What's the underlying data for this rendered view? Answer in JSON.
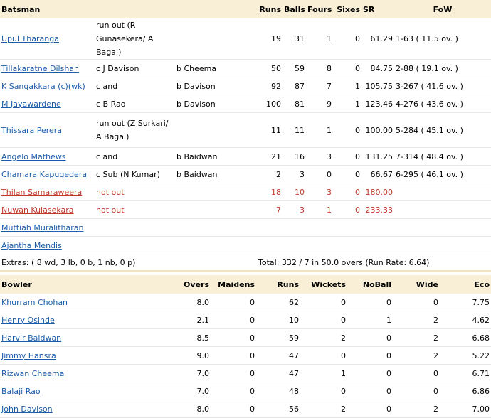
{
  "batting": {
    "headers": {
      "batsman": "Batsman",
      "runs": "Runs",
      "balls": "Balls",
      "fours": "Fours",
      "sixes": "Sixes",
      "sr": "SR",
      "fow": "FoW"
    },
    "rows": [
      {
        "name": "Upul Tharanga",
        "how1": "run out (R Gunasekera/ A Bagai)",
        "how2": "",
        "runs": "19",
        "balls": "31",
        "fours": "1",
        "sixes": "0",
        "sr": "61.29",
        "fow": "1-63 ( 11.5 ov. )"
      },
      {
        "name": "Tillakaratne Dilshan",
        "how1": "c J Davison",
        "how2": "b Cheema",
        "runs": "50",
        "balls": "59",
        "fours": "8",
        "sixes": "0",
        "sr": "84.75",
        "fow": "2-88 ( 19.1 ov. )"
      },
      {
        "name": "K Sangakkara (c)(wk)",
        "how1": "c and",
        "how2": "b Davison",
        "runs": "92",
        "balls": "87",
        "fours": "7",
        "sixes": "1",
        "sr": "105.75",
        "fow": "3-267 ( 41.6 ov. )"
      },
      {
        "name": "M Jayawardene",
        "how1": "c B Rao",
        "how2": "b Davison",
        "runs": "100",
        "balls": "81",
        "fours": "9",
        "sixes": "1",
        "sr": "123.46",
        "fow": "4-276 ( 43.6 ov. )"
      },
      {
        "name": "Thissara Perera",
        "how1": "run out (Z Surkari/ A Bagai)",
        "how2": "",
        "runs": "11",
        "balls": "11",
        "fours": "1",
        "sixes": "0",
        "sr": "100.00",
        "fow": "5-284 ( 45.1 ov. )"
      },
      {
        "name": "Angelo Mathews",
        "how1": "c and",
        "how2": "b Baidwan",
        "runs": "21",
        "balls": "16",
        "fours": "3",
        "sixes": "0",
        "sr": "131.25",
        "fow": "7-314 ( 48.4 ov. )"
      },
      {
        "name": "Chamara Kapugedera",
        "how1": "c Sub (N Kumar)",
        "how2": "b Baidwan",
        "runs": "2",
        "balls": "3",
        "fours": "0",
        "sixes": "0",
        "sr": "66.67",
        "fow": "6-295 ( 46.1 ov. )"
      },
      {
        "name": "Thilan Samaraweera",
        "how1": "not out",
        "how2": "",
        "runs": "18",
        "balls": "10",
        "fours": "3",
        "sixes": "0",
        "sr": "180.00",
        "fow": ""
      },
      {
        "name": "Nuwan Kulasekara",
        "how1": "not out",
        "how2": "",
        "runs": "7",
        "balls": "3",
        "fours": "1",
        "sixes": "0",
        "sr": "233.33",
        "fow": ""
      },
      {
        "name": "Muttiah Muralitharan",
        "how1": "",
        "how2": "",
        "runs": "",
        "balls": "",
        "fours": "",
        "sixes": "",
        "sr": "",
        "fow": ""
      },
      {
        "name": "Ajantha Mendis",
        "how1": "",
        "how2": "",
        "runs": "",
        "balls": "",
        "fours": "",
        "sixes": "",
        "sr": "",
        "fow": ""
      }
    ],
    "extras": "Extras: ( 8 wd, 3 lb, 0 b, 1 nb, 0 p)",
    "total": "Total: 332 / 7 in 50.0 overs (Run Rate: 6.64)"
  },
  "bowling": {
    "headers": {
      "bowler": "Bowler",
      "overs": "Overs",
      "maidens": "Maidens",
      "runs": "Runs",
      "wickets": "Wickets",
      "noball": "NoBall",
      "wide": "Wide",
      "eco": "Eco"
    },
    "rows": [
      {
        "name": "Khurram Chohan",
        "overs": "8.0",
        "maidens": "0",
        "runs": "62",
        "wickets": "0",
        "noball": "0",
        "wide": "0",
        "eco": "7.75"
      },
      {
        "name": "Henry Osinde",
        "overs": "2.1",
        "maidens": "0",
        "runs": "10",
        "wickets": "0",
        "noball": "1",
        "wide": "2",
        "eco": "4.62"
      },
      {
        "name": "Harvir Baidwan",
        "overs": "8.5",
        "maidens": "0",
        "runs": "59",
        "wickets": "2",
        "noball": "0",
        "wide": "2",
        "eco": "6.68"
      },
      {
        "name": "Jimmy Hansra",
        "overs": "9.0",
        "maidens": "0",
        "runs": "47",
        "wickets": "0",
        "noball": "0",
        "wide": "2",
        "eco": "5.22"
      },
      {
        "name": "Rizwan Cheema",
        "overs": "7.0",
        "maidens": "0",
        "runs": "47",
        "wickets": "1",
        "noball": "0",
        "wide": "0",
        "eco": "6.71"
      },
      {
        "name": "Balaji Rao",
        "overs": "7.0",
        "maidens": "0",
        "runs": "48",
        "wickets": "0",
        "noball": "0",
        "wide": "0",
        "eco": "6.86"
      },
      {
        "name": "John Davison",
        "overs": "8.0",
        "maidens": "0",
        "runs": "56",
        "wickets": "2",
        "noball": "0",
        "wide": "2",
        "eco": "7.00"
      }
    ]
  }
}
